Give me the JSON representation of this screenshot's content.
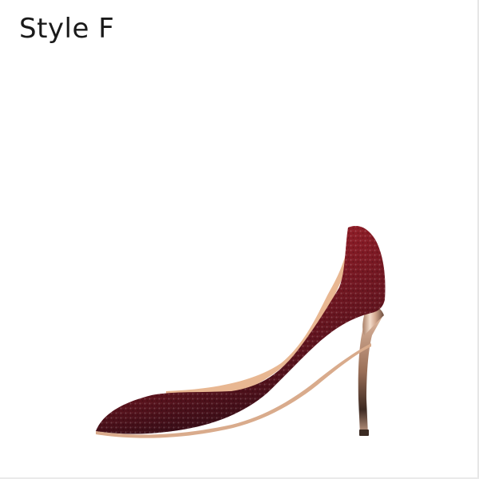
{
  "label": {
    "text": "Style F"
  },
  "product": {
    "icon": "high-heel-pump-icon",
    "colors": {
      "upper_top": "#8e1a22",
      "upper_mid": "#6a1420",
      "upper_toe": "#2a0d16",
      "heel_metal_light": "#f1d3bf",
      "heel_metal_dark": "#7c5a48",
      "lining": "#e7b48d",
      "background": "#ffffff"
    }
  }
}
